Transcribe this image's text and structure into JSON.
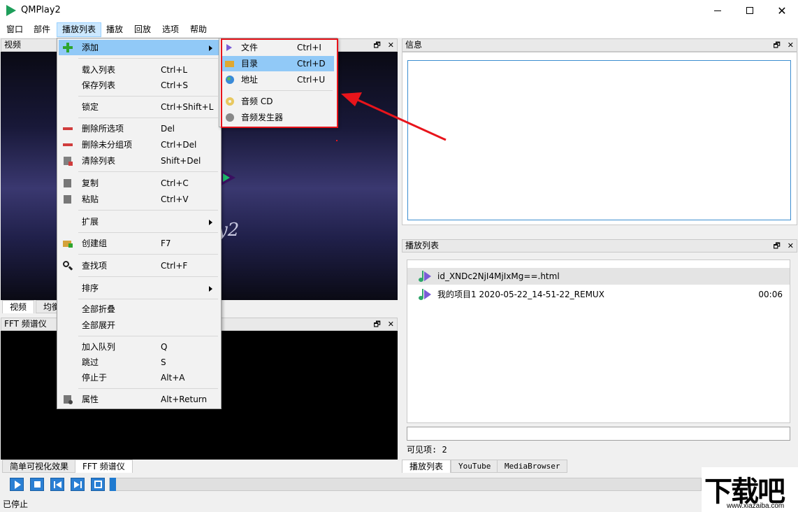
{
  "window": {
    "title": "QMPlay2"
  },
  "menubar": {
    "items": [
      "窗口",
      "部件",
      "播放列表",
      "播放",
      "回放",
      "选项",
      "帮助"
    ]
  },
  "docks": {
    "video": "视频",
    "fft": "FFT 频谱仪",
    "info": "信息",
    "playlist": "播放列表"
  },
  "video_tabs": [
    "视频",
    "均衡"
  ],
  "bottom_left_tabs": [
    "简单可视化效果",
    "FFT 频谱仪"
  ],
  "video_logo_text": "y2",
  "context_menu": [
    {
      "label": "添加",
      "shortcut": "",
      "submenu": true
    },
    {
      "label": "载入列表",
      "shortcut": "Ctrl+L"
    },
    {
      "label": "保存列表",
      "shortcut": "Ctrl+S"
    },
    {
      "label": "锁定",
      "shortcut": "Ctrl+Shift+L"
    },
    {
      "label": "删除所选项",
      "shortcut": "Del"
    },
    {
      "label": "删除未分组项",
      "shortcut": "Ctrl+Del"
    },
    {
      "label": "清除列表",
      "shortcut": "Shift+Del"
    },
    {
      "label": "复制",
      "shortcut": "Ctrl+C"
    },
    {
      "label": "粘贴",
      "shortcut": "Ctrl+V"
    },
    {
      "label": "扩展",
      "shortcut": "",
      "submenu": true
    },
    {
      "label": "创建组",
      "shortcut": "F7"
    },
    {
      "label": "查找项",
      "shortcut": "Ctrl+F"
    },
    {
      "label": "排序",
      "shortcut": "",
      "submenu": true
    },
    {
      "label": "全部折叠",
      "shortcut": ""
    },
    {
      "label": "全部展开",
      "shortcut": ""
    },
    {
      "label": "加入队列",
      "shortcut": "Q"
    },
    {
      "label": "跳过",
      "shortcut": "S"
    },
    {
      "label": "停止于",
      "shortcut": "Alt+A"
    },
    {
      "label": "属性",
      "shortcut": "Alt+Return"
    }
  ],
  "add_submenu": [
    {
      "label": "文件",
      "shortcut": "Ctrl+I"
    },
    {
      "label": "目录",
      "shortcut": "Ctrl+D"
    },
    {
      "label": "地址",
      "shortcut": "Ctrl+U"
    },
    {
      "label": "音频 CD",
      "shortcut": ""
    },
    {
      "label": "音频发生器",
      "shortcut": ""
    }
  ],
  "playlist": {
    "items": [
      {
        "name": "id_XNDc2NjI4MjIxMg==.html",
        "duration": ""
      },
      {
        "name": "我的项目1 2020-05-22_14-51-22_REMUX",
        "duration": "00:06"
      }
    ],
    "visible_count": "可见项: 2",
    "tabs": [
      "播放列表",
      "YouTube",
      "MediaBrowser"
    ]
  },
  "status": "已停止",
  "watermark": {
    "main": "下载吧",
    "sub": "www.xiazaiba.com"
  },
  "colors": {
    "highlight": "#91c9f7",
    "annotation_red": "#e8141b",
    "accent_blue": "#2a7fd4"
  }
}
